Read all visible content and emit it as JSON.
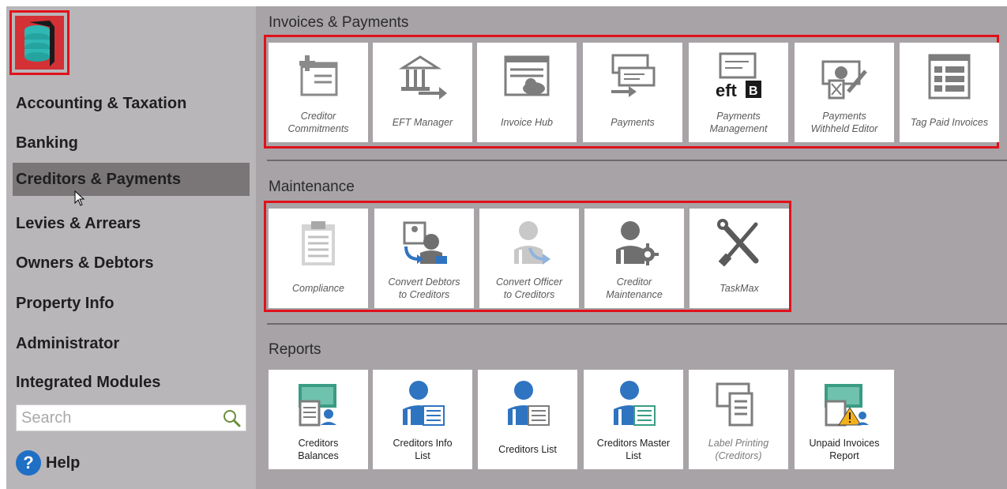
{
  "sidebar": {
    "nav": [
      {
        "label": "Accounting & Taxation",
        "active": false
      },
      {
        "label": "Banking",
        "active": false
      },
      {
        "label": "Creditors & Payments",
        "active": true
      },
      {
        "label": "Levies & Arrears",
        "active": false
      },
      {
        "label": "Owners & Debtors",
        "active": false
      },
      {
        "label": "Property Info",
        "active": false
      },
      {
        "label": "Administrator",
        "active": false
      },
      {
        "label": "Integrated Modules",
        "active": false
      }
    ],
    "search_placeholder": "Search",
    "help_label": "Help"
  },
  "sections": {
    "invoices": {
      "title": "Invoices & Payments",
      "tiles": [
        {
          "label": "Creditor\nCommitments",
          "icon": "creditor-commitments-icon"
        },
        {
          "label": "EFT Manager",
          "icon": "eft-manager-icon"
        },
        {
          "label": "Invoice Hub",
          "icon": "invoice-hub-icon"
        },
        {
          "label": "Payments",
          "icon": "payments-icon"
        },
        {
          "label": "Payments\nManagement",
          "icon": "payments-management-icon",
          "icon_text": "eft"
        },
        {
          "label": "Payments\nWithheld Editor",
          "icon": "payments-withheld-icon"
        },
        {
          "label": "Tag Paid Invoices",
          "icon": "tag-paid-invoices-icon"
        }
      ]
    },
    "maintenance": {
      "title": "Maintenance",
      "tiles": [
        {
          "label": "Compliance",
          "icon": "clipboard-icon"
        },
        {
          "label": "Convert Debtors\nto Creditors",
          "icon": "convert-debtors-icon"
        },
        {
          "label": "Convert Officer\nto Creditors",
          "icon": "convert-officer-icon"
        },
        {
          "label": "Creditor\nMaintenance",
          "icon": "creditor-maintenance-icon"
        },
        {
          "label": "TaskMax",
          "icon": "tools-icon"
        }
      ]
    },
    "reports": {
      "title": "Reports",
      "tiles": [
        {
          "label": "Creditors\nBalances",
          "icon": "creditors-balances-icon"
        },
        {
          "label": "Creditors Info\nList",
          "icon": "creditors-info-icon"
        },
        {
          "label": "Creditors List",
          "icon": "creditors-list-icon"
        },
        {
          "label": "Creditors Master\nList",
          "icon": "creditors-master-icon"
        },
        {
          "label": "Label Printing\n(Creditors)",
          "icon": "label-printing-icon",
          "dim": true
        },
        {
          "label": "Unpaid Invoices\nReport",
          "icon": "unpaid-invoices-icon"
        }
      ]
    }
  },
  "colors": {
    "sidebar_bg": "#b9b6b9",
    "main_bg": "#a7a3a7",
    "highlight_frame": "#e0111a",
    "icon_gray": "#7d7d7d",
    "icon_blue": "#2f74c0",
    "icon_green": "#3a9c84"
  }
}
